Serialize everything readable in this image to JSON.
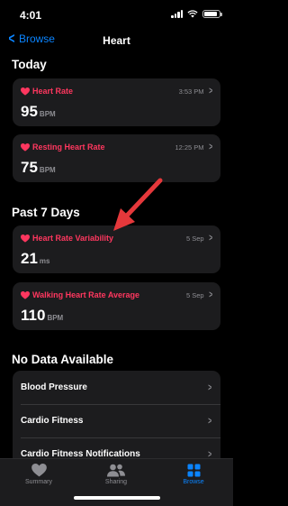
{
  "status_bar": {
    "time": "4:01"
  },
  "nav": {
    "back_label": "Browse",
    "title": "Heart"
  },
  "sections": {
    "today": "Today",
    "past7": "Past 7 Days",
    "no_data": "No Data Available"
  },
  "cards": [
    {
      "title": "Heart Rate",
      "meta": "3:53 PM",
      "value": "95",
      "unit": "BPM"
    },
    {
      "title": "Resting Heart Rate",
      "meta": "12:25 PM",
      "value": "75",
      "unit": "BPM"
    },
    {
      "title": "Heart Rate Variability",
      "meta": "5 Sep",
      "value": "21",
      "unit": "ms"
    },
    {
      "title": "Walking Heart Rate Average",
      "meta": "5 Sep",
      "value": "110",
      "unit": "BPM"
    }
  ],
  "no_data_items": [
    "Blood Pressure",
    "Cardio Fitness",
    "Cardio Fitness Notifications"
  ],
  "tabs": [
    {
      "label": "Summary",
      "icon": "heart-icon"
    },
    {
      "label": "Sharing",
      "icon": "people-icon"
    },
    {
      "label": "Browse",
      "icon": "grid-icon"
    }
  ],
  "active_tab": "Browse",
  "colors": {
    "accent": "#0a84ff",
    "heart": "#ff375f",
    "annotation_arrow": "#e5383b"
  }
}
